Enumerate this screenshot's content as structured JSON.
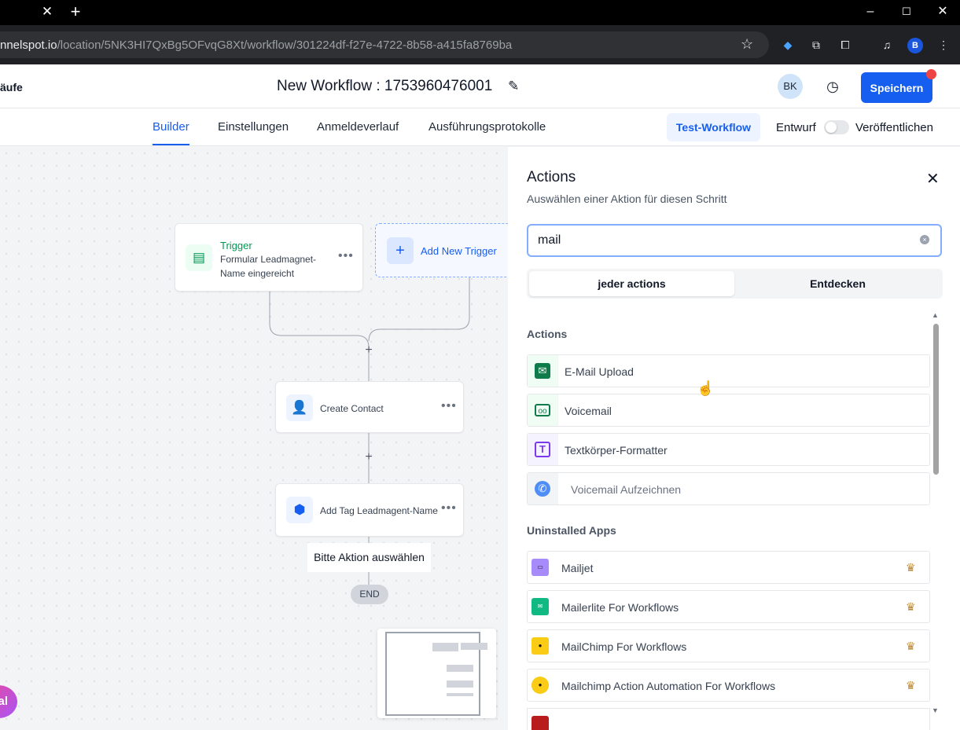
{
  "browser": {
    "tab_close": "✕",
    "new_tab": "+",
    "window_controls": [
      "–",
      "☐",
      "✕"
    ],
    "url_host": "nnelspot.io",
    "url_path": "/location/5NK3HI7QxBg5OFvqG8Xt/workflow/301224df-f27e-4722-8b58-a415fa8769ba",
    "profile_initial": "B"
  },
  "header": {
    "left_text": "äufe",
    "workflow_title": "New Workflow : 1753960476001",
    "avatar": "BK",
    "save_label": "Speichern"
  },
  "tabs": {
    "items": [
      "Builder",
      "Einstellungen",
      "Anmeldeverlauf",
      "Ausführungsprotokolle"
    ],
    "test_workflow": "Test-Workflow",
    "draft_label": "Entwurf",
    "publish_label": "Veröffentlichen"
  },
  "canvas": {
    "trigger_title": "Trigger",
    "trigger_desc_line1": "Formular Leadmagnet-",
    "trigger_desc_line2": "Name eingereicht",
    "add_trigger": "Add New Trigger",
    "node_create_contact": "Create Contact",
    "node_add_tag": "Add Tag Leadmagent-Name",
    "hint": "Bitte Aktion auswählen",
    "end": "END",
    "fab_text": "al"
  },
  "panel": {
    "title": "Actions",
    "subtitle": "Auswählen einer Aktion für diesen Schritt",
    "search_value": "mail",
    "segments": [
      "jeder actions",
      "Entdecken"
    ],
    "actions_section": "Actions",
    "actions": [
      {
        "label": "E-Mail Upload",
        "icon": "email-open-icon"
      },
      {
        "label": "Voicemail",
        "icon": "voicemail-icon"
      },
      {
        "label": "Textkörper-Formatter",
        "icon": "text-format-icon"
      },
      {
        "label": "Voicemail Aufzeichnen",
        "icon": "phone-record-icon"
      }
    ],
    "apps_section": "Uninstalled Apps",
    "apps": [
      {
        "label": "Mailjet",
        "icon": "mailjet-logo"
      },
      {
        "label": "Mailerlite For Workflows",
        "icon": "mailerlite-logo"
      },
      {
        "label": "MailChimp For Workflows",
        "icon": "mailchimp-logo"
      },
      {
        "label": "Mailchimp Action Automation For Workflows",
        "icon": "mailchimp-monkey-logo"
      }
    ]
  },
  "colors": {
    "primary": "#155eef",
    "trigger_green": "#039855",
    "alert_red": "#ef4444",
    "crown_gold": "#b7873b"
  }
}
